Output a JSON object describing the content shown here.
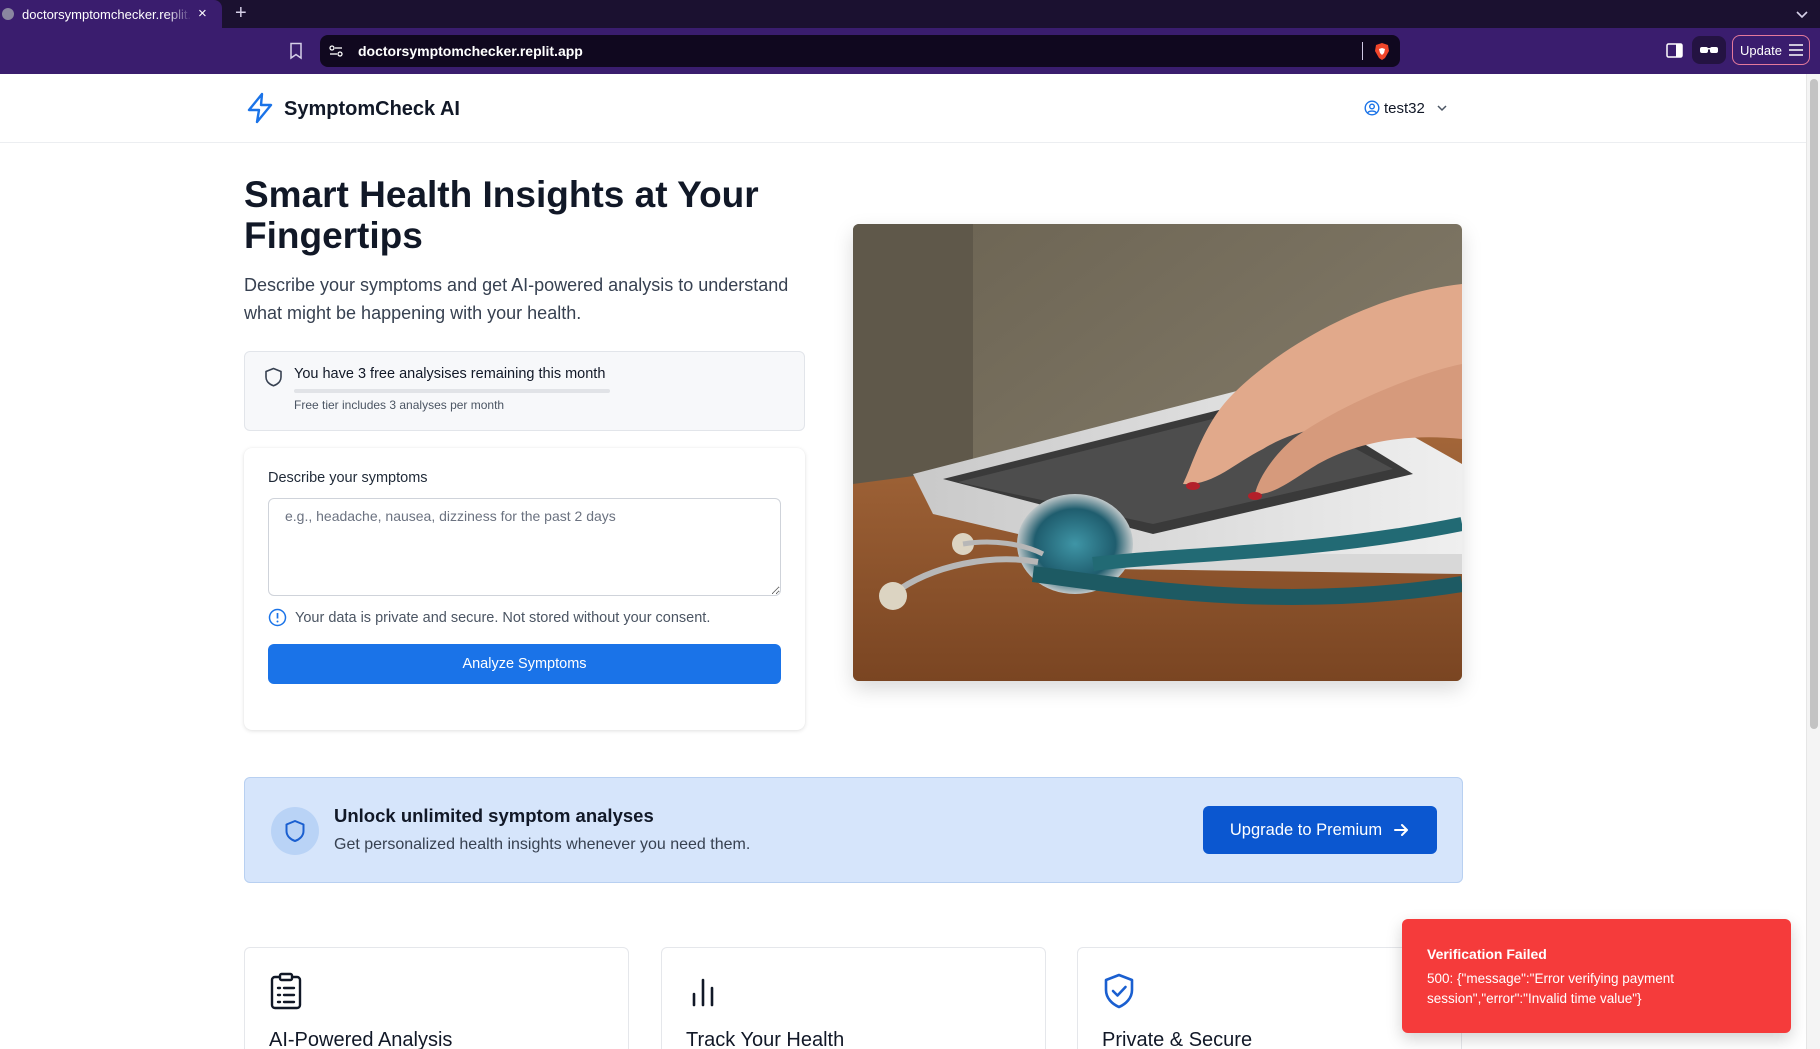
{
  "browser": {
    "tab_title": "doctorsymptomchecker.replit.app",
    "tab_close": "×",
    "new_tab": "+",
    "url": "doctorsymptomchecker.replit.app",
    "update_label": "Update"
  },
  "header": {
    "brand": "SymptomCheck AI",
    "user_name": "test32"
  },
  "hero": {
    "title": "Smart Health Insights at Your Fingertips",
    "subtitle": "Describe your symptoms and get AI-powered analysis to understand what might be happening with your health."
  },
  "quota": {
    "message": "You have 3 free analysises remaining this month",
    "note": "Free tier includes 3 analyses per month",
    "used_fraction": 0
  },
  "form": {
    "label": "Describe your symptoms",
    "placeholder": "e.g., headache, nausea, dizziness for the past 2 days",
    "value": "",
    "privacy": "Your data is private and secure. Not stored without your consent.",
    "submit_label": "Analyze Symptoms"
  },
  "upsell": {
    "title": "Unlock unlimited symptom analyses",
    "subtitle": "Get personalized health insights whenever you need them.",
    "button_label": "Upgrade to Premium"
  },
  "features": [
    {
      "icon": "clipboard-list-icon",
      "title": "AI-Powered Analysis"
    },
    {
      "icon": "bar-chart-icon",
      "title": "Track Your Health"
    },
    {
      "icon": "shield-check-icon",
      "title": "Private & Secure"
    }
  ],
  "toast": {
    "title": "Verification Failed",
    "message": "500: {\"message\":\"Error verifying payment session\",\"error\":\"Invalid time value\"}"
  },
  "colors": {
    "primary": "#1a73e8",
    "premium_button": "#0b57d0",
    "upsell_bg": "#d6e5fb",
    "toast_bg": "#f53b3b",
    "browser_chrome": "#3a1d6e"
  }
}
